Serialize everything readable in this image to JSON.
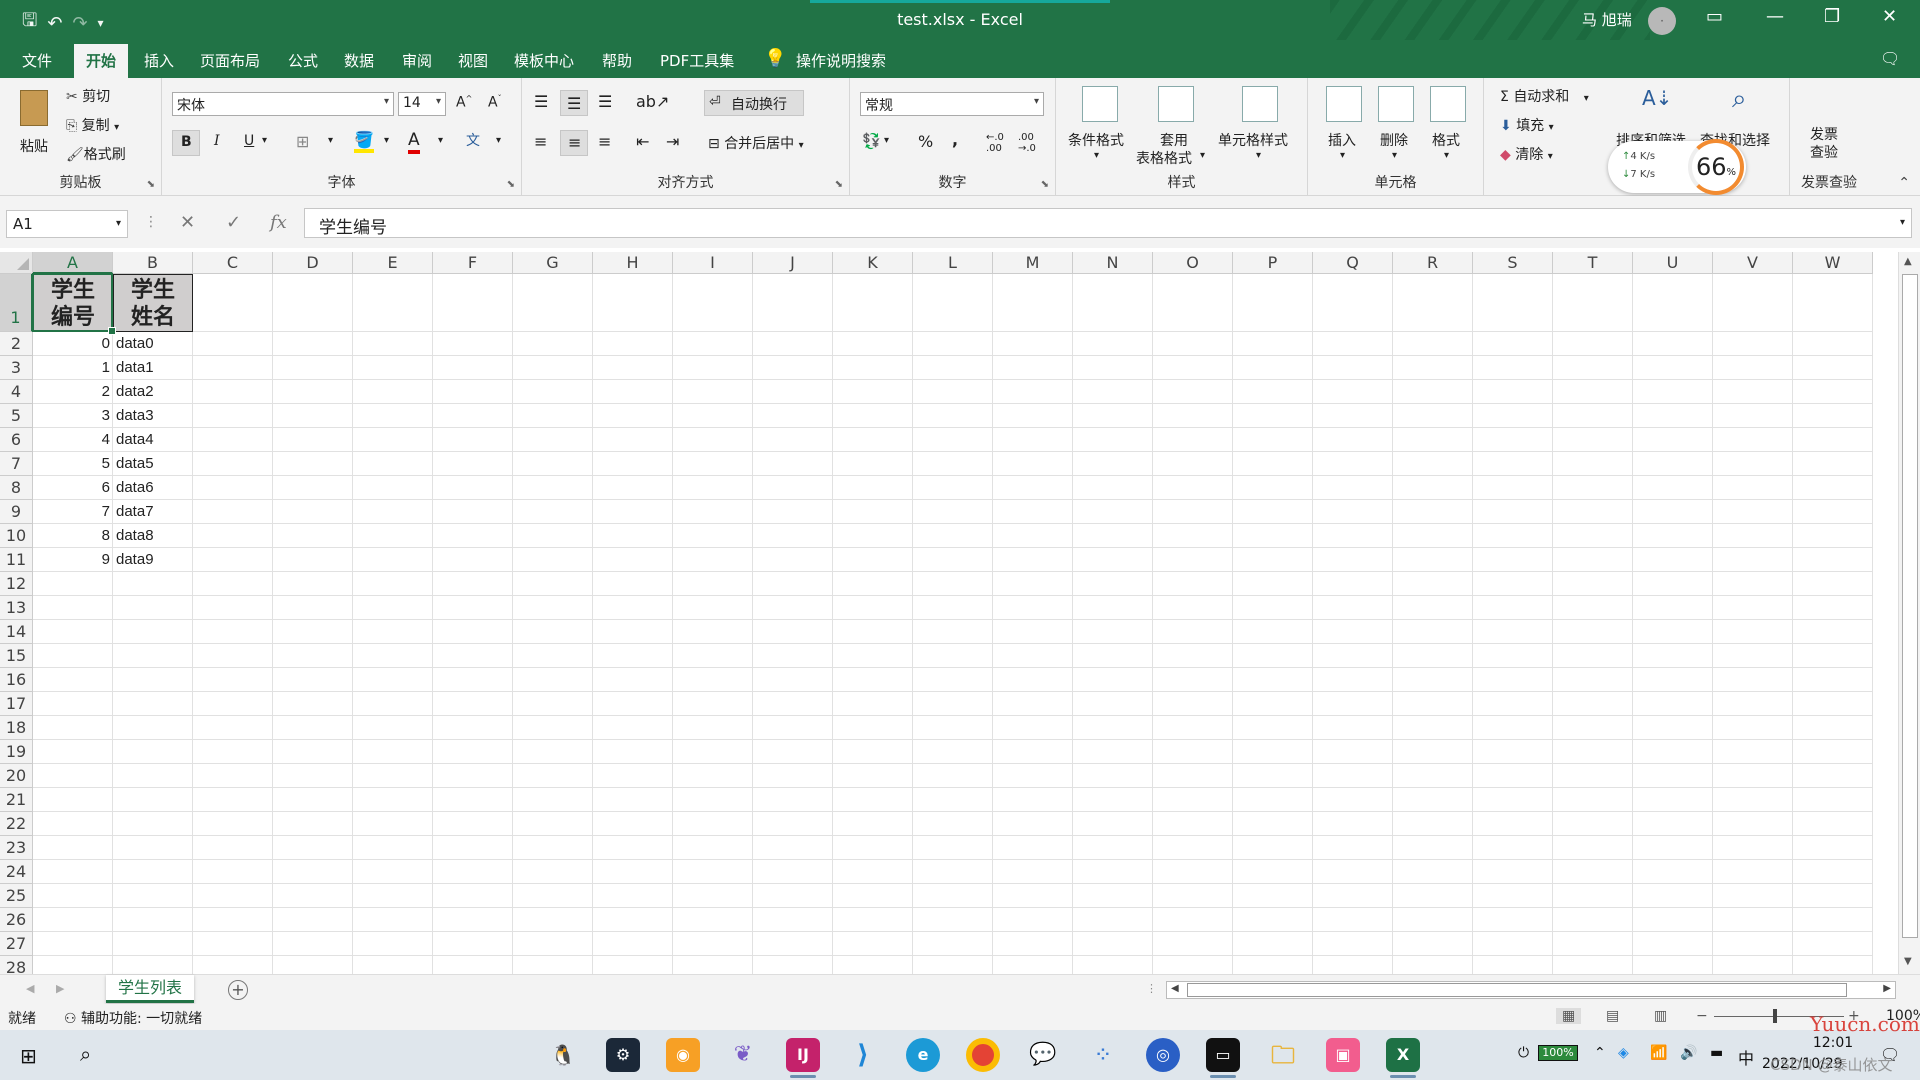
{
  "window": {
    "title": "test.xlsx  -  Excel",
    "user": "马 旭瑞",
    "avatar_initial": "·"
  },
  "tabs": [
    "文件",
    "开始",
    "插入",
    "页面布局",
    "公式",
    "数据",
    "审阅",
    "视图",
    "模板中心",
    "帮助",
    "PDF工具集"
  ],
  "active_tab": "开始",
  "tell_me": "操作说明搜索",
  "ribbon": {
    "clipboard": {
      "paste": "粘贴",
      "cut": "剪切",
      "copy": "复制",
      "format_painter": "格式刷",
      "label": "剪贴板"
    },
    "font": {
      "name": "宋体",
      "size": "14",
      "bold": "B",
      "italic": "I",
      "underline": "U",
      "label": "字体"
    },
    "alignment": {
      "wrap": "自动换行",
      "merge": "合并后居中",
      "label": "对齐方式"
    },
    "number": {
      "format": "常规",
      "percent": "%",
      "comma": ",",
      "label": "数字"
    },
    "styles": {
      "conditional": "条件格式",
      "table_l1": "套用",
      "table_l2": "表格格式",
      "cell_styles": "单元格样式",
      "label": "样式"
    },
    "cells": {
      "insert": "插入",
      "delete": "删除",
      "format": "格式",
      "label": "单元格"
    },
    "editing": {
      "autosum": "自动求和",
      "fill": "填充",
      "clear": "清除",
      "sort": "排序和筛选",
      "find": "查找和选择"
    },
    "invoice": {
      "l1": "发票",
      "l2": "查验",
      "label": "发票查验"
    }
  },
  "net_widget": {
    "up": "4  K/s",
    "down": "7  K/s",
    "percent": "66",
    "percent_unit": "%"
  },
  "formula_bar": {
    "name_box": "A1",
    "content": "学生编号",
    "fx": "fx"
  },
  "grid": {
    "columns": [
      "A",
      "B",
      "C",
      "D",
      "E",
      "F",
      "G",
      "H",
      "I",
      "J",
      "K",
      "L",
      "M",
      "N",
      "O",
      "P",
      "Q",
      "R",
      "S",
      "T",
      "U",
      "V",
      "W"
    ],
    "row_numbers": [
      "1",
      "2",
      "3",
      "4",
      "5",
      "6",
      "7",
      "8",
      "9",
      "10",
      "11",
      "12",
      "13",
      "14",
      "15",
      "16",
      "17",
      "18",
      "19",
      "20",
      "21",
      "22",
      "23",
      "24",
      "25",
      "26",
      "27",
      "28"
    ],
    "headers": [
      "学生编号",
      "学生姓名"
    ],
    "rows": [
      [
        "0",
        "data0"
      ],
      [
        "1",
        "data1"
      ],
      [
        "2",
        "data2"
      ],
      [
        "3",
        "data3"
      ],
      [
        "4",
        "data4"
      ],
      [
        "5",
        "data5"
      ],
      [
        "6",
        "data6"
      ],
      [
        "7",
        "data7"
      ],
      [
        "8",
        "data8"
      ],
      [
        "9",
        "data9"
      ]
    ]
  },
  "sheet_tab": "学生列表",
  "status": {
    "ready": "就绪",
    "accessibility": "辅助功能: 一切就绪",
    "zoom": "100%"
  },
  "taskbar": {
    "battery": "100%",
    "ime": "中",
    "time": "12:01",
    "date": "2022/10/29"
  },
  "watermarks": {
    "site": "Yuucn.com",
    "csdn": "CSDN @泰山依文"
  },
  "colors": {
    "excel_green": "#217346",
    "ribbon_bg": "#f3f3f3",
    "header_fill": "#d0cece"
  }
}
